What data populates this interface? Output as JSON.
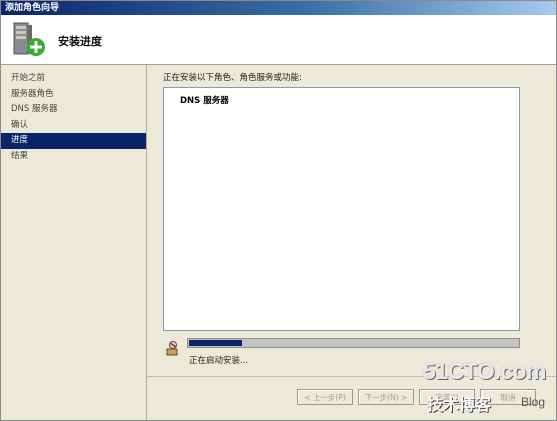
{
  "window": {
    "title": "添加角色向导"
  },
  "header": {
    "title": "安装进度",
    "icon": "server-add-icon"
  },
  "sidebar": {
    "items": [
      {
        "label": "开始之前",
        "active": false
      },
      {
        "label": "服务器角色",
        "active": false
      },
      {
        "label": "DNS 服务器",
        "active": false
      },
      {
        "label": "确认",
        "active": false
      },
      {
        "label": "进度",
        "active": true
      },
      {
        "label": "结果",
        "active": false
      }
    ]
  },
  "main": {
    "lead_text": "正在安装以下角色、角色服务或功能:",
    "results": [
      {
        "label": "DNS 服务器"
      }
    ],
    "progress": {
      "fraction": 0.16
    },
    "status_text": "正在启动安装..."
  },
  "footer": {
    "prev_label": "< 上一步(P)",
    "next_label": "下一步(N) >",
    "install_label": "安装(I)",
    "cancel_label": "取消"
  },
  "watermark": {
    "brand": "51CTO.com",
    "cn": "技术博客",
    "blog": "Blog"
  },
  "colors": {
    "accent": "#0a246a",
    "titlebar_end": "#a6caf0",
    "border": "#7f9db9"
  }
}
